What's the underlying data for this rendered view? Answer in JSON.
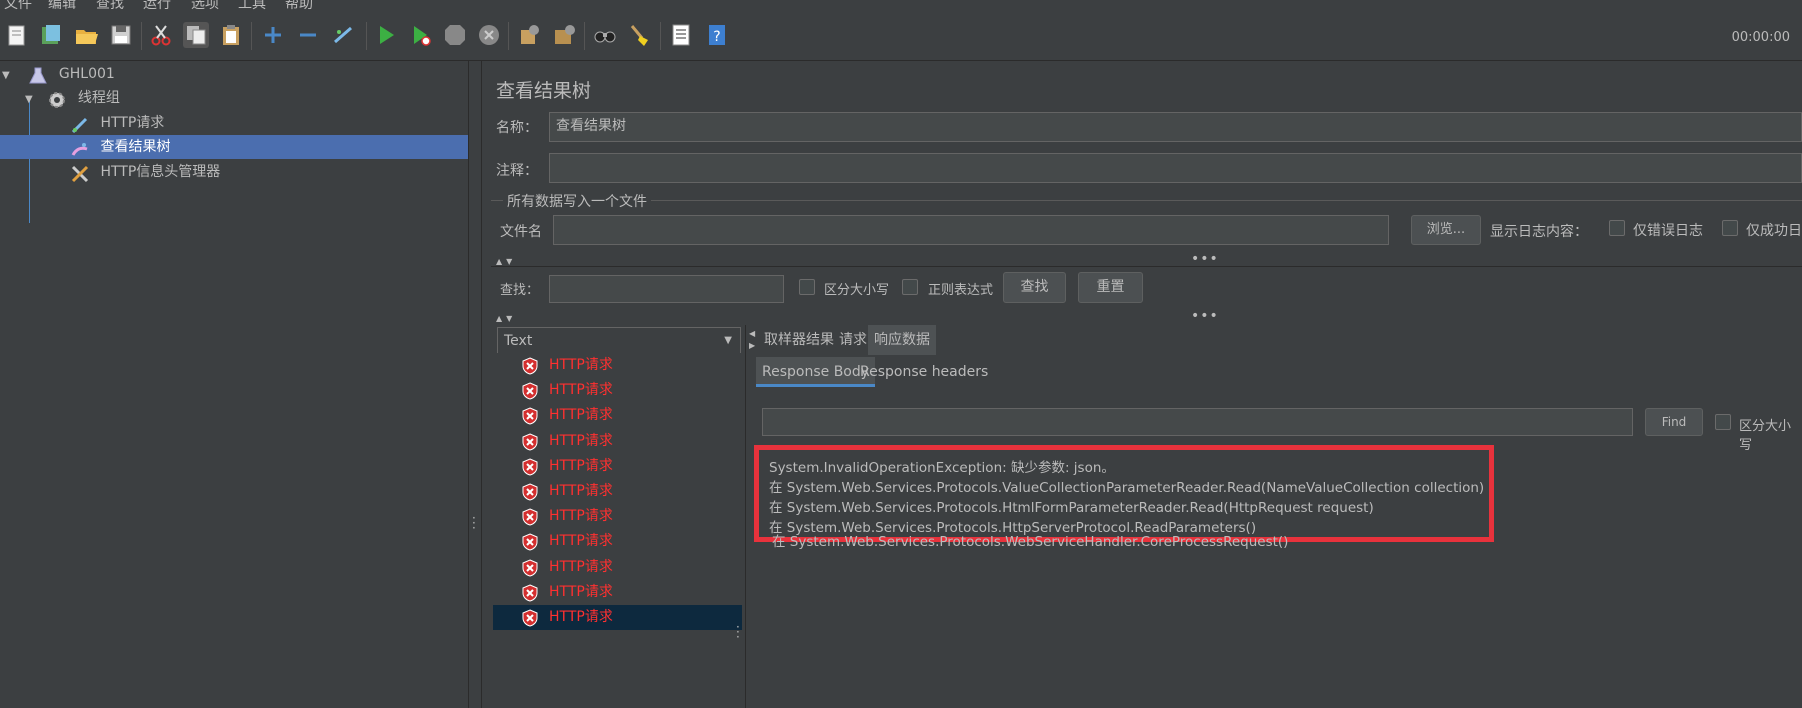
{
  "menu": [
    "文件",
    "编辑",
    "查找",
    "运行",
    "选项",
    "工具",
    "帮助"
  ],
  "toolbar": {
    "icons": [
      "new-icon",
      "templates-icon",
      "open-icon",
      "save-icon",
      "cut-icon",
      "copy-icon",
      "paste-icon",
      "expand-icon",
      "collapse-icon",
      "toggle-icon",
      "start-icon",
      "start-no-timers-icon",
      "stop-icon",
      "shutdown-icon",
      "clear-icon",
      "clear-all-icon",
      "search-icon",
      "reset-search-icon",
      "function-helper-icon",
      "help-icon"
    ],
    "timer": "00:00:00"
  },
  "tree": [
    {
      "label": "GHL001",
      "icon": "test-plan-icon",
      "level": 0,
      "expanded": true
    },
    {
      "label": "线程组",
      "icon": "gear-icon",
      "level": 1,
      "expanded": true
    },
    {
      "label": "HTTP请求",
      "icon": "sampler-icon",
      "level": 2
    },
    {
      "label": "查看结果树",
      "icon": "listener-icon",
      "level": 2,
      "selected": true
    },
    {
      "label": "HTTP信息头管理器",
      "icon": "config-icon",
      "level": 2
    }
  ],
  "panel": {
    "title": "查看结果树",
    "name_label": "名称：",
    "name_value": "查看结果树",
    "comment_label": "注释：",
    "comment_value": "",
    "file_section_title": "所有数据写入一个文件",
    "filename_label": "文件名",
    "filename_value": "",
    "browse_button": "浏览...",
    "log_content_label": "显示日志内容：",
    "errors_only_label": "仅错误日志",
    "success_only_label": "仅成功日"
  },
  "search": {
    "label": "查找：",
    "value": "",
    "case_label": "区分大小写",
    "regex_label": "正则表达式",
    "find_button": "查找",
    "reset_button": "重置"
  },
  "renderer": {
    "selected": "Text"
  },
  "results": [
    {
      "label": "HTTP请求",
      "status": "error"
    },
    {
      "label": "HTTP请求",
      "status": "error"
    },
    {
      "label": "HTTP请求",
      "status": "error"
    },
    {
      "label": "HTTP请求",
      "status": "error"
    },
    {
      "label": "HTTP请求",
      "status": "error"
    },
    {
      "label": "HTTP请求",
      "status": "error"
    },
    {
      "label": "HTTP请求",
      "status": "error"
    },
    {
      "label": "HTTP请求",
      "status": "error"
    },
    {
      "label": "HTTP请求",
      "status": "error"
    },
    {
      "label": "HTTP请求",
      "status": "error"
    },
    {
      "label": "HTTP请求",
      "status": "error",
      "selected": true
    }
  ],
  "detail": {
    "tabs": [
      "取样器结果",
      "请求",
      "响应数据"
    ],
    "active_tab": "响应数据",
    "subtabs": [
      "Response Body",
      "Response headers"
    ],
    "active_subtab": "Response Body",
    "find_value": "",
    "find_button": "Find",
    "case_label": "区分大小写",
    "response_lines": [
      "System.InvalidOperationException: 缺少参数: json。",
      "   在 System.Web.Services.Protocols.ValueCollectionParameterReader.Read(NameValueCollection collection)",
      "   在 System.Web.Services.Protocols.HtmlFormParameterReader.Read(HttpRequest request)",
      "   在 System.Web.Services.Protocols.HttpServerProtocol.ReadParameters()",
      "   在 System.Web.Services.Protocols.WebServiceHandler.CoreProcessRequest()"
    ]
  },
  "colors": {
    "background": "#3c3f41",
    "selection": "#4b6eaf",
    "error_text": "#ff3030",
    "highlight_border": "#e8323c"
  }
}
